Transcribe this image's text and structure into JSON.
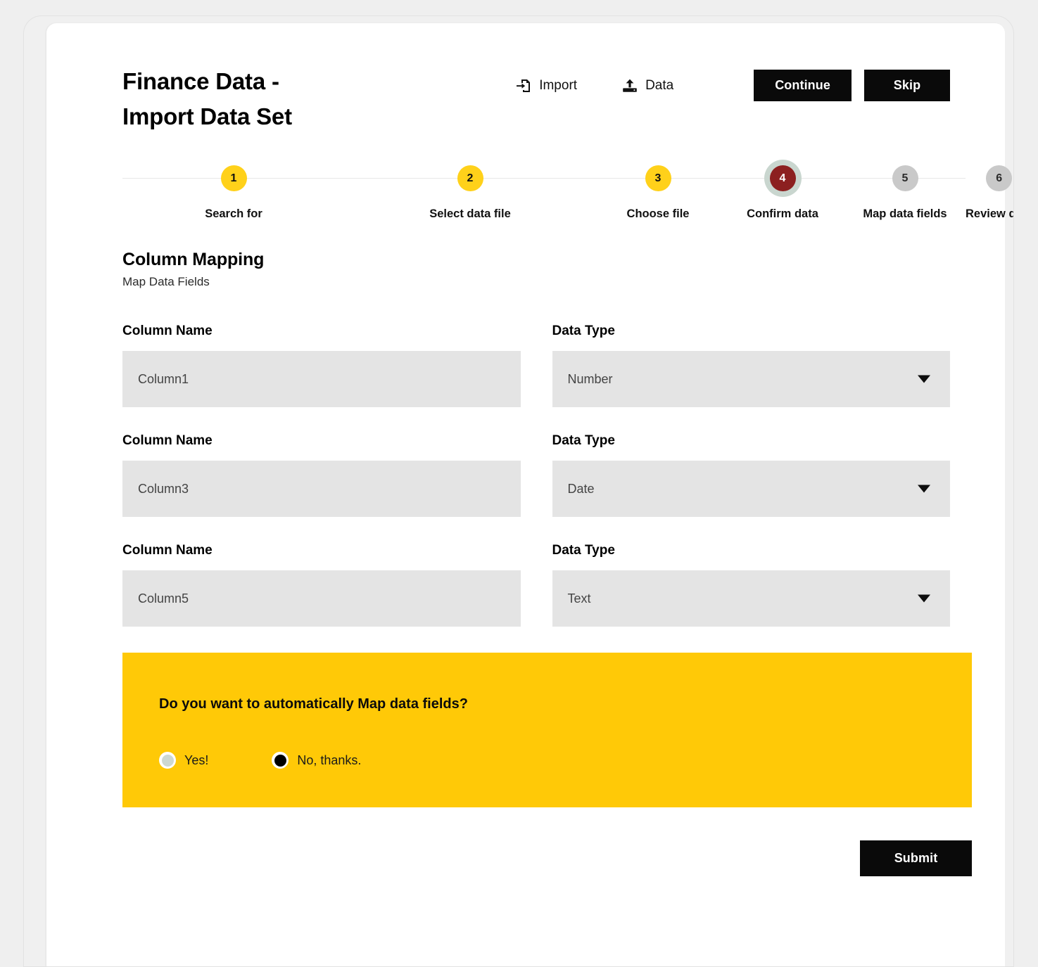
{
  "header": {
    "title_line1": "Finance Data -",
    "title_line2": "Import Data Set",
    "toolbar": {
      "import_label": "Import",
      "import_icon": "file-import-icon",
      "data_label": "Data",
      "data_icon": "upload-icon",
      "continue_label": "Continue",
      "skip_label": "Skip"
    }
  },
  "stepper": {
    "steps": [
      {
        "number": "1",
        "label": "Search for",
        "state": "done"
      },
      {
        "number": "2",
        "label": "Select data file",
        "state": "done"
      },
      {
        "number": "3",
        "label": "Choose file",
        "state": "done"
      },
      {
        "number": "4",
        "label": "Confirm data",
        "state": "active"
      },
      {
        "number": "5",
        "label": "Map data fields",
        "state": "pending"
      },
      {
        "number": "6",
        "label": "Review data",
        "state": "pending"
      }
    ]
  },
  "section": {
    "title": "Column Mapping",
    "subtitle": "Map Data Fields"
  },
  "mapping": {
    "column_label": "Column Name",
    "type_label": "Data Type",
    "rows": [
      {
        "column_name": "Column1",
        "data_type": "Number"
      },
      {
        "column_name": "Column3",
        "data_type": "Date"
      },
      {
        "column_name": "Column5",
        "data_type": "Text"
      }
    ]
  },
  "automap": {
    "question": "Do you want to automatically Map data fields?",
    "options": [
      {
        "label": "Yes!",
        "selected": false
      },
      {
        "label": "No, thanks.",
        "selected": true
      }
    ]
  },
  "footer": {
    "submit_label": "Submit"
  },
  "colors": {
    "accent_yellow": "#FFC907",
    "step_yellow": "#FFD11A",
    "active_step_red": "#8C2020",
    "active_ring": "#C9D6CF",
    "pending_gray": "#C9C9C9",
    "field_bg": "#E4E4E4",
    "button_black": "#0A0A0A"
  }
}
